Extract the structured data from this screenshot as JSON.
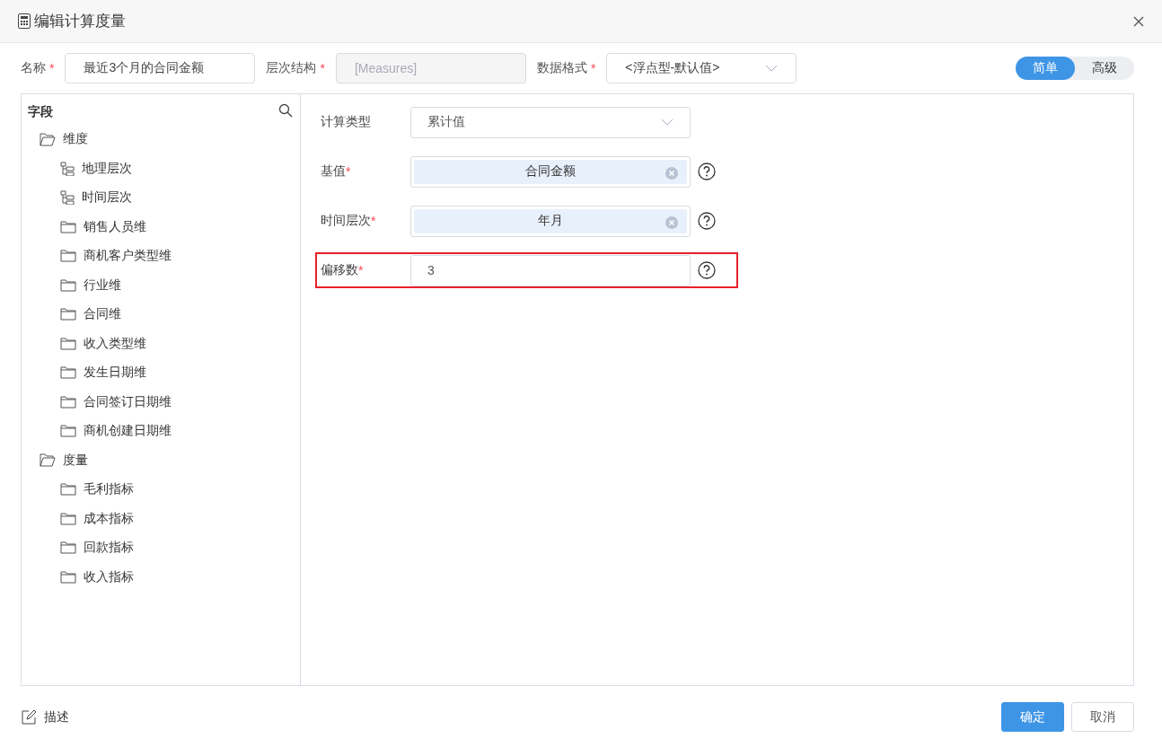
{
  "window": {
    "title": "编辑计算度量"
  },
  "header_fields": [
    {
      "label": "名称",
      "required_mark": "*",
      "kind": "input",
      "value": "最近3个月的合同金额",
      "disabled": false
    },
    {
      "label": "层次结构",
      "required_mark": "*",
      "kind": "input",
      "value": "[Measures]",
      "disabled": true
    },
    {
      "label": "数据格式",
      "required_mark": "*",
      "kind": "select",
      "value": "<浮点型-默认值>",
      "disabled": false
    }
  ],
  "mode_toggle": [
    {
      "label": "简单",
      "selected": true
    },
    {
      "label": "高级",
      "selected": false
    }
  ],
  "field_panel": {
    "title": "字段",
    "tree": [
      {
        "label": "维度",
        "kind": "folder",
        "expanded": true,
        "children": [
          {
            "label": "地理层次",
            "kind": "hierarchy"
          },
          {
            "label": "时间层次",
            "kind": "hierarchy"
          },
          {
            "label": "销售人员维",
            "kind": "folder",
            "expanded": false
          },
          {
            "label": "商机客户类型维",
            "kind": "folder",
            "expanded": false
          },
          {
            "label": "行业维",
            "kind": "folder",
            "expanded": false
          },
          {
            "label": "合同维",
            "kind": "folder",
            "expanded": false
          },
          {
            "label": "收入类型维",
            "kind": "folder",
            "expanded": false
          },
          {
            "label": "发生日期维",
            "kind": "folder",
            "expanded": false
          },
          {
            "label": "合同签订日期维",
            "kind": "folder",
            "expanded": false
          },
          {
            "label": "商机创建日期维",
            "kind": "folder",
            "expanded": false
          }
        ]
      },
      {
        "label": "度量",
        "kind": "folder",
        "expanded": true,
        "children": [
          {
            "label": "毛利指标",
            "kind": "folder",
            "expanded": false
          },
          {
            "label": "成本指标",
            "kind": "folder",
            "expanded": false
          },
          {
            "label": "回款指标",
            "kind": "folder",
            "expanded": false
          },
          {
            "label": "收入指标",
            "kind": "folder",
            "expanded": false
          }
        ]
      }
    ]
  },
  "form_rows": [
    {
      "label": "计算类型",
      "kind": "select",
      "value": "累计值",
      "help": false,
      "highlighted": false
    },
    {
      "label": "基值",
      "required_mark": "*",
      "kind": "tag",
      "value": "合同金额",
      "help": true,
      "highlighted": false
    },
    {
      "label": "时间层次",
      "required_mark": "*",
      "kind": "tag",
      "value": "年月",
      "help": true,
      "highlighted": false
    },
    {
      "label": "偏移数",
      "required_mark": "*",
      "kind": "input",
      "value": "3",
      "help": true,
      "highlighted": true
    }
  ],
  "footer": {
    "description_link": "描述",
    "buttons": [
      {
        "label": "确定",
        "kind": "primary"
      },
      {
        "label": "取消",
        "kind": "secondary"
      }
    ]
  }
}
